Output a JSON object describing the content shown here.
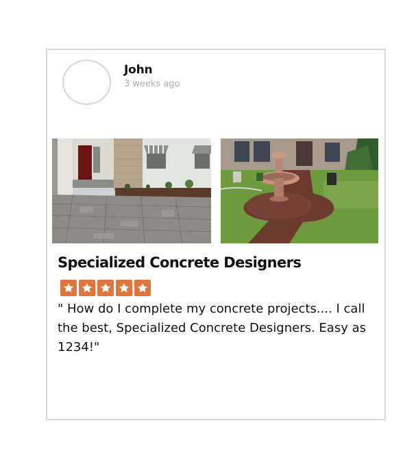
{
  "review": {
    "author_name": "John",
    "timestamp": "3 weeks ago",
    "business_name": "Specialized Concrete Designers",
    "rating": 5,
    "rating_max": 5,
    "text": "\" How do I complete my concrete projects.... I call the best, Specialized Concrete Designers. Easy as 1234!\"",
    "photos": [
      {
        "subject": "stamped concrete driveway in front of house"
      },
      {
        "subject": "stamped concrete walkway with fountain"
      }
    ]
  },
  "colors": {
    "star_background": "#e2763a",
    "card_border": "#d9d9d9",
    "timestamp_text": "#b0b0b0"
  },
  "icons": {
    "avatar": "avatar-placeholder-circle",
    "rating_star": "star-icon"
  }
}
